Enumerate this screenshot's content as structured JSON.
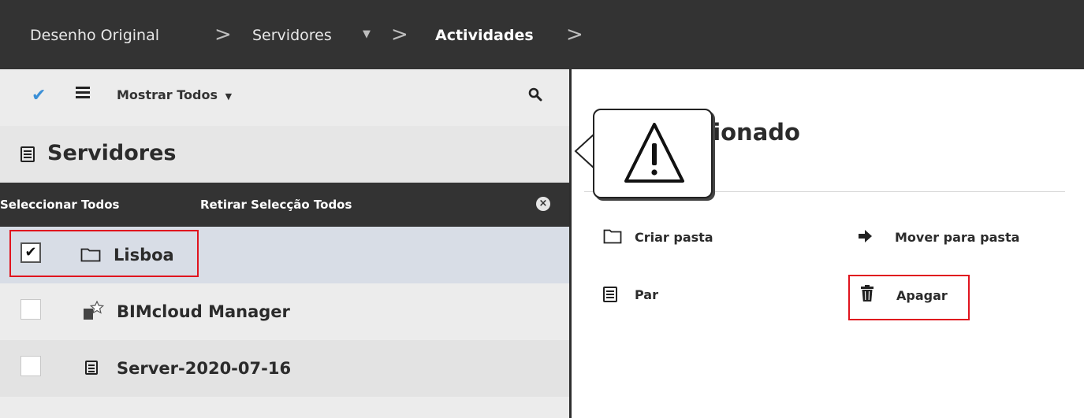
{
  "breadcrumb": {
    "items": [
      "Desenho Original",
      "Servidores",
      "Actividades"
    ],
    "separator": ">"
  },
  "toolbar": {
    "filter_label": "Mostrar Todos",
    "icons": [
      "check-icon",
      "list-icon",
      "caret-down-icon",
      "search-icon"
    ]
  },
  "section": {
    "title": "Servidores",
    "icon": "server-icon"
  },
  "selection_bar": {
    "select_all": "Seleccionar Todos",
    "deselect_all": "Retirar Selecção Todos",
    "clear_icon": "close-circle-icon"
  },
  "items": [
    {
      "label": "Lisboa",
      "checked": true,
      "icon": "folder-icon"
    },
    {
      "label": "BIMcloud Manager",
      "checked": false,
      "icon": "manager-star-icon"
    },
    {
      "label": "Server-2020-07-16",
      "checked": false,
      "icon": "server-icon"
    }
  ],
  "details": {
    "title_visible": "cionado",
    "actions": {
      "create_folder": "Criar pasta",
      "move_to_folder": "Mover para pasta",
      "pair": "Par",
      "delete": "Apagar"
    }
  },
  "colors": {
    "topbar": "#333333",
    "highlight": "#e0141e",
    "accent_check": "#3a8fd6",
    "selected_row": "#d8dde6"
  },
  "callout_icon": "warning-icon"
}
